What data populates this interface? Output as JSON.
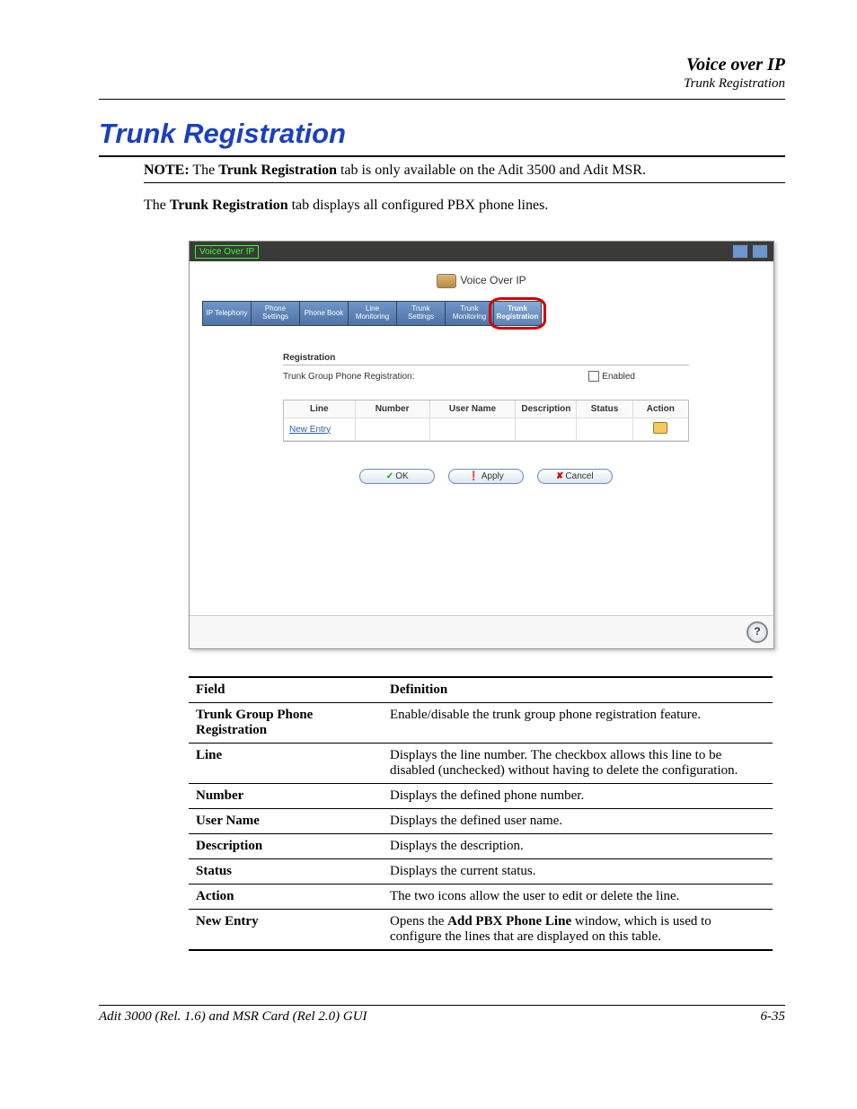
{
  "header": {
    "section": "Voice over IP",
    "subsection": "Trunk Registration"
  },
  "title": "Trunk Registration",
  "note": {
    "prefix": "NOTE:",
    "text_before": "  The ",
    "strong": "Trunk Registration",
    "text_after": " tab is only available on the Adit 3500 and Adit MSR."
  },
  "intro": {
    "before": "The ",
    "strong": "Trunk Registration",
    "after": " tab displays all configured PBX phone lines."
  },
  "screenshot": {
    "titlebar": "Voice Over IP",
    "heading": "Voice Over IP",
    "tabs": [
      "IP Telephony",
      "Phone Settings",
      "Phone Book",
      "Line Monitoring",
      "Trunk Settings",
      "Trunk Monitoring",
      "Trunk Registration"
    ],
    "active_tab_index": 6,
    "registration": {
      "section_title": "Registration",
      "label": "Trunk Group Phone Registration:",
      "checkbox_label": "Enabled"
    },
    "table": {
      "columns": [
        "Line",
        "Number",
        "User Name",
        "Description",
        "Status",
        "Action"
      ],
      "new_entry_label": "New Entry"
    },
    "buttons": {
      "ok": "OK",
      "apply": "Apply",
      "cancel": "Cancel"
    },
    "help_icon": "?"
  },
  "definitions": {
    "header_field": "Field",
    "header_def": "Definition",
    "rows": [
      {
        "field": "Trunk Group Phone Registration",
        "def": "Enable/disable the trunk group phone registration feature."
      },
      {
        "field": "Line",
        "def": "Displays the line number. The checkbox allows this line to be disabled (unchecked) without having to delete the configuration."
      },
      {
        "field": "Number",
        "def": "Displays the defined phone number."
      },
      {
        "field": "User Name",
        "def": "Displays the defined user name."
      },
      {
        "field": "Description",
        "def": "Displays the description."
      },
      {
        "field": "Status",
        "def": "Displays the current status."
      },
      {
        "field": "Action",
        "def": "The two icons allow the user to edit or delete the line."
      }
    ],
    "new_entry": {
      "field": "New Entry",
      "before": "Opens the ",
      "strong": "Add PBX Phone Line",
      "after": " window, which is used to configure the lines that are displayed on this table."
    }
  },
  "footer": {
    "left": "Adit 3000 (Rel. 1.6) and MSR Card (Rel 2.0) GUI",
    "right": "6-35"
  }
}
